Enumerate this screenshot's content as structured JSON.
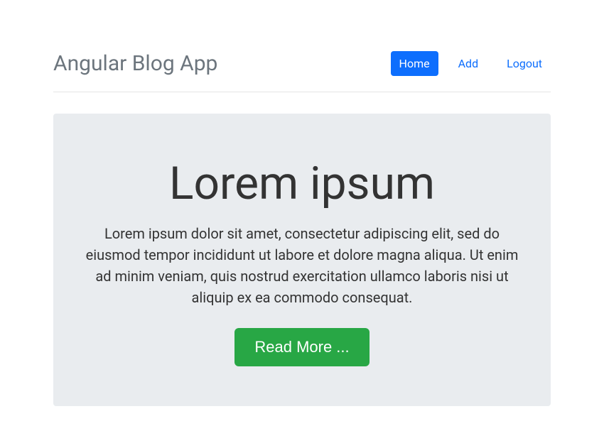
{
  "brand": "Angular Blog App",
  "nav": {
    "home": "Home",
    "add": "Add",
    "logout": "Logout"
  },
  "post": {
    "title": "Lorem ipsum",
    "excerpt": "Lorem ipsum dolor sit amet, consectetur adipiscing elit, sed do eiusmod tempor incididunt ut labore et dolore magna aliqua. Ut enim ad minim veniam, quis nostrud exercitation ullamco laboris nisi ut aliquip ex ea commodo consequat.",
    "read_more_label": "Read More ..."
  }
}
